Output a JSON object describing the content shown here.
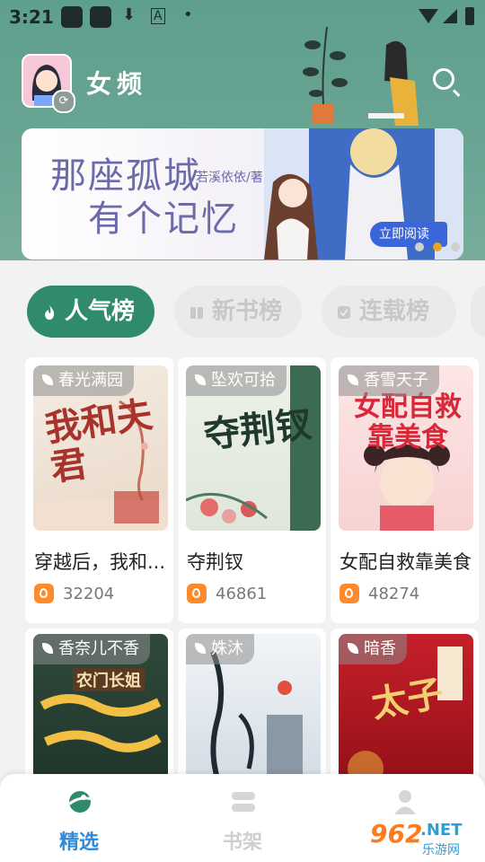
{
  "status_bar": {
    "time": "3:21"
  },
  "header": {
    "channel": "女频",
    "search_icon": "search-icon"
  },
  "banner": {
    "title_line1": "那座孤城",
    "title_line2": "有个记忆",
    "author": "若溪依依/著",
    "cta": "立即阅读",
    "page_count": 3,
    "active_page": 2
  },
  "tabs": [
    {
      "label": "人气榜",
      "active": true
    },
    {
      "label": "新书榜",
      "active": false
    },
    {
      "label": "连载榜",
      "active": false
    }
  ],
  "books": [
    {
      "author": "春光满园",
      "title": "穿越后，我和...",
      "hot": "32204",
      "cover_text": "我和夫君"
    },
    {
      "author": "坠欢可拾",
      "title": "夺荆钗",
      "hot": "46861",
      "cover_text": "夺荆钗"
    },
    {
      "author": "香雪天子",
      "title": "女配自救靠美食",
      "hot": "48274",
      "cover_text": "女配自救靠美食"
    },
    {
      "author": "香奈儿不香",
      "title": "",
      "hot": "",
      "cover_text": "农门长姐"
    },
    {
      "author": "姝沐",
      "title": "",
      "hot": "",
      "cover_text": ""
    },
    {
      "author": "暗香",
      "title": "",
      "hot": "",
      "cover_text": "太子"
    }
  ],
  "bottom_nav": [
    {
      "label": "精选",
      "active": true
    },
    {
      "label": "书架",
      "active": false
    },
    {
      "label": "",
      "active": false
    }
  ],
  "watermark": {
    "number": "962",
    "suffix": ".NET",
    "site": "乐游网"
  },
  "colors": {
    "accent": "#2f8a6e",
    "hot": "#ff8a2c",
    "nav_active": "#2f8ad8"
  }
}
